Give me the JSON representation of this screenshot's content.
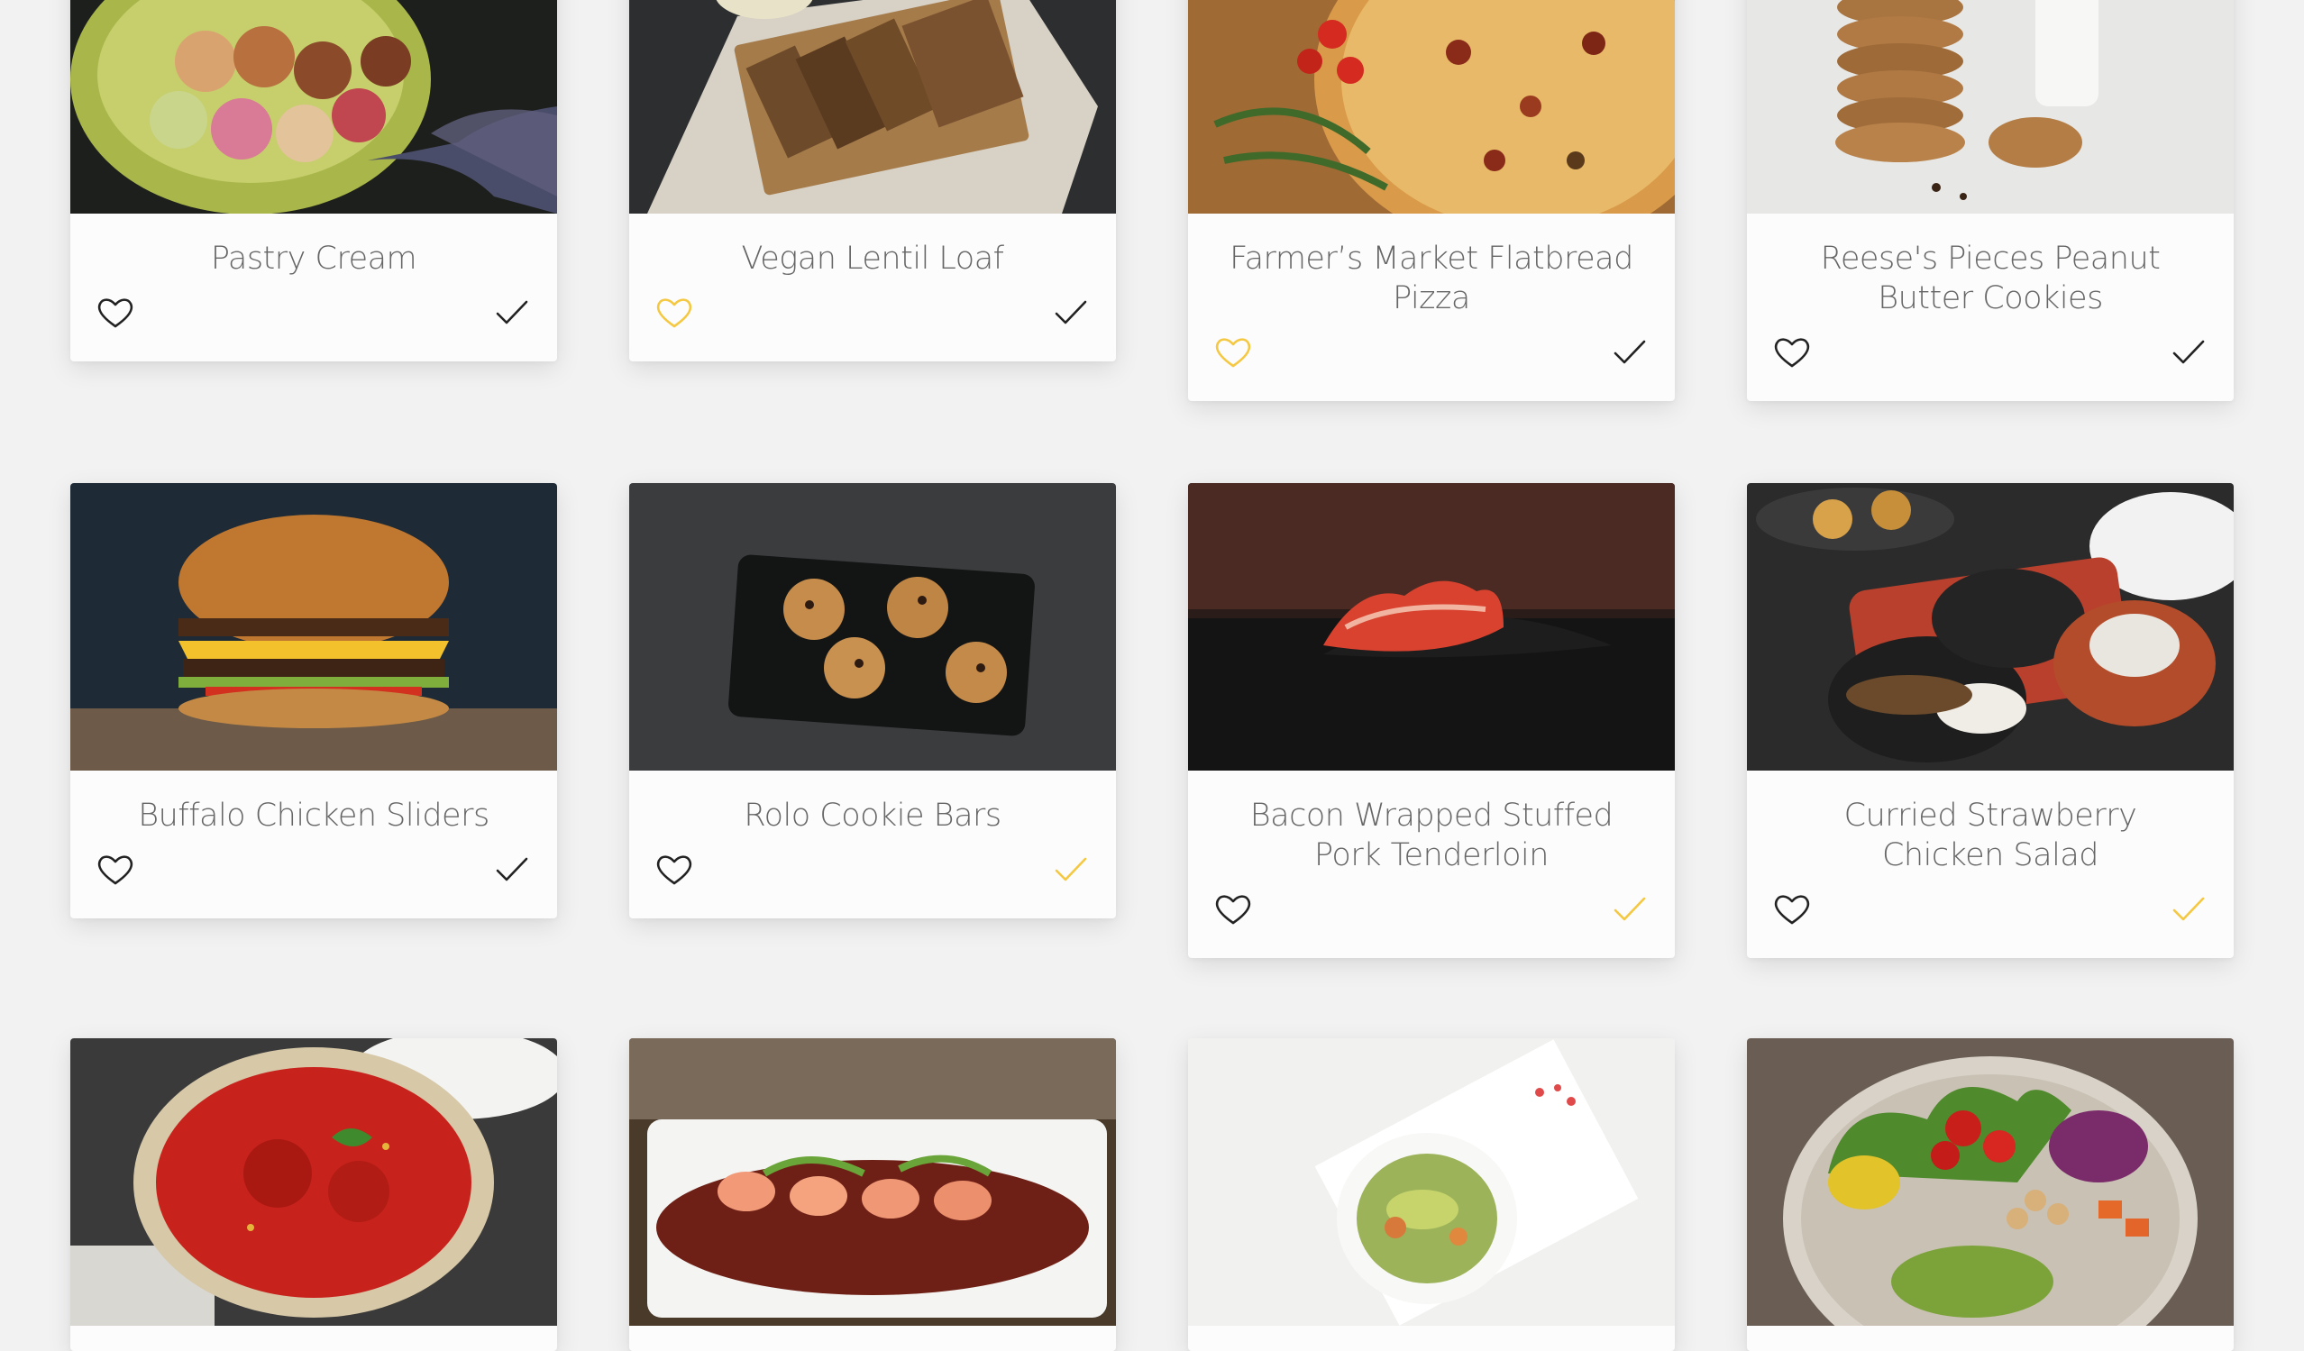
{
  "colors": {
    "page_background": "#f2f2f2",
    "card_background": "#fcfcfc",
    "title_text": "#666666",
    "icon_default": "#222222",
    "icon_active": "#f5c842"
  },
  "recipes": [
    {
      "title": "Pastry Cream",
      "favorite": false,
      "done": false,
      "photo": "macarons-bowl-photo"
    },
    {
      "title": "Vegan Lentil Loaf",
      "favorite": true,
      "done": false,
      "photo": "sliced-bread-photo"
    },
    {
      "title": "Farmer’s Market Flatbread Pizza",
      "favorite": true,
      "done": false,
      "photo": "flatbread-pizza-photo"
    },
    {
      "title": "Reese's Pieces Peanut Butter Cookies",
      "favorite": false,
      "done": false,
      "photo": "cookie-stack-photo"
    },
    {
      "title": "Buffalo Chicken Sliders",
      "favorite": false,
      "done": false,
      "photo": "burger-photo"
    },
    {
      "title": "Rolo Cookie Bars",
      "favorite": false,
      "done": true,
      "photo": "cookies-tray-photo"
    },
    {
      "title": "Bacon Wrapped Stuffed Pork Tenderloin",
      "favorite": false,
      "done": true,
      "photo": "sushi-slice-photo"
    },
    {
      "title": "Curried Strawberry Chicken Salad",
      "favorite": false,
      "done": true,
      "photo": "plated-dishes-photo"
    },
    {
      "title": "",
      "favorite": false,
      "done": false,
      "photo": "tomato-meatballs-photo"
    },
    {
      "title": "",
      "favorite": false,
      "done": false,
      "photo": "shrimp-plate-photo"
    },
    {
      "title": "",
      "favorite": false,
      "done": false,
      "photo": "salad-bowl-photo"
    },
    {
      "title": "",
      "favorite": false,
      "done": false,
      "photo": "vegetable-bowl-photo"
    }
  ]
}
